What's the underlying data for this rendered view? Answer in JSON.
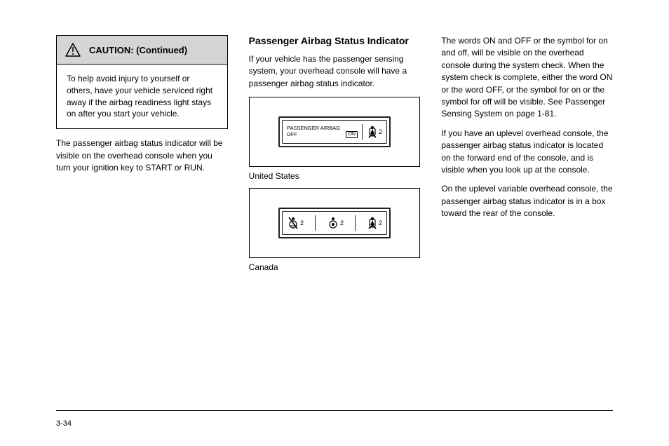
{
  "warning": {
    "title": "CAUTION: (Continued)",
    "body": "To help avoid injury to yourself or others, have your vehicle serviced right away if the airbag readiness light stays on after you start your vehicle."
  },
  "col1_para": "The passenger airbag status indicator will be visible on the overhead console when you turn your ignition key to START or RUN.",
  "col2": {
    "heading": "Passenger Airbag Status Indicator",
    "para1": "If your vehicle has the passenger sensing system, your overhead console will have a passenger airbag status indicator.",
    "caption_a": "United States",
    "caption_b": "Canada",
    "panel_a": {
      "line1": "PASSENGER AIRBAG",
      "off": "OFF",
      "on": "ON",
      "seatbelt_num": "2"
    },
    "panel_b": {
      "num_a": "2",
      "num_b": "2",
      "num_c": "2"
    }
  },
  "col3": {
    "para1": "The words ON and OFF or the symbol for on and off, will be visible on the overhead console during the system check. When the system check is complete, either the word ON or the word OFF, or the symbol for on or the symbol for off will be visible. See Passenger Sensing System on page 1-81.",
    "para2": "If you have an uplevel overhead console, the passenger airbag status indicator is located on the forward end of the console, and is visible when you look up at the console.",
    "para3": "On the uplevel variable overhead console, the passenger airbag status indicator is in a box toward the rear of the console."
  },
  "page_num": "3-34"
}
